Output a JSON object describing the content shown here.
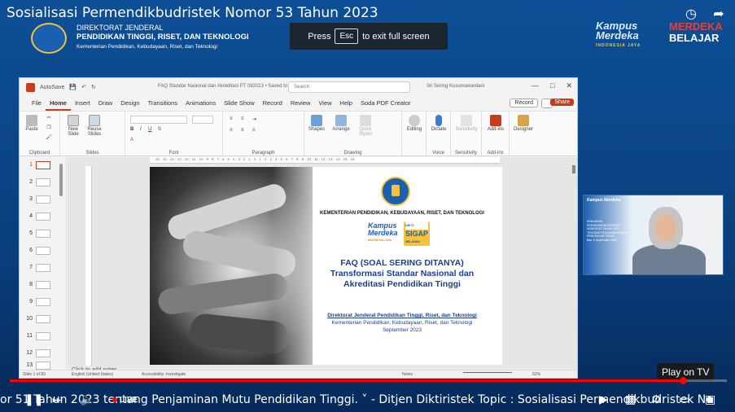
{
  "video": {
    "title": "Sosialisasi Permendikbudristek Nomor 53 Tahun 2023",
    "fullscreen_hint_press": "Press",
    "fullscreen_hint_key": "Esc",
    "fullscreen_hint_rest": "to exit full screen",
    "play_on_tv": "Play on TV",
    "live_label": "LIVE",
    "progress_fraction": 0.94,
    "ticker": "or 51 Tahun 2023 tentang Penjaminan Mutu Pendidikan Tinggi. ˅  -  Ditjen Diktiristek Topic : Sosialisasi Permendikbudristek No"
  },
  "branding": {
    "dirjen_line1": "DIREKTORAT JENDERAL",
    "dirjen_line2": "PENDIDIKAN TINGGI, RISET, DAN TEKNOLOGI",
    "dirjen_line3": "Kementerian Pendidikan, Kebudayaan, Riset, dan Teknologi",
    "km_line1": "Kampus",
    "km_line2": "Merdeka",
    "km_sub": "INDONESIA JAYA",
    "mb_line1": "MERDEKA",
    "mb_line2": "BELAJAR"
  },
  "ppt": {
    "titlebar": {
      "autosave": "AutoSave",
      "doc_title": "FAQ Standar Nasional dan Akreditasi PT 092023 • Saved to this PC",
      "search": "Search",
      "user": "Sri Sering Kusumawardani"
    },
    "menu": [
      "File",
      "Home",
      "Insert",
      "Draw",
      "Design",
      "Transitions",
      "Animations",
      "Slide Show",
      "Record",
      "Review",
      "View",
      "Help",
      "Soda PDF Creator"
    ],
    "record_label": "Record",
    "share_label": "Share",
    "ribbon": {
      "clipboard": "Clipboard",
      "paste": "Paste",
      "slides": "Slides",
      "new_slide": "New Slide",
      "reuse_slides": "Reuse Slides",
      "font": "Font",
      "paragraph": "Paragraph",
      "drawing": "Drawing",
      "shapes": "Shapes",
      "arrange": "Arrange",
      "quick_styles": "Quick Styles",
      "editing": "Editing",
      "voice": "Voice",
      "dictate": "Dictate",
      "sensitivity_group": "Sensitivity",
      "sensitivity": "Sensitivity",
      "addins_group": "Add-ins",
      "addins": "Add-ins",
      "designer": "Designer"
    },
    "thumbnails": [
      "1",
      "2",
      "3",
      "4",
      "5",
      "6",
      "7",
      "8",
      "9",
      "10",
      "11",
      "12",
      "13"
    ],
    "notes_placeholder": "Click to add notes",
    "status": {
      "slide": "Slide 1 of 83",
      "language": "English (United States)",
      "accessibility": "Accessibility: Investigate",
      "notes": "Notes",
      "zoom": "62%"
    },
    "ruler": "· 16 · 15 · 14 · 13 · 12 · 11 · 10 · 9 · 8 · 7 · 6 · 5 · 4 · 3 · 2 · 1 · 0 · 1 · 2 · 3 · 4 · 5 · 6 · 7 · 8 · 9 · 10 · 11 · 12 · 13 · 14 · 15 · 16 ·"
  },
  "slide": {
    "ministry": "KEMENTERIAN PENDIDIKAN, KEBUDAYAAN, RISET, DAN TEKNOLOGI",
    "km_line1": "Kampus",
    "km_line2": "Merdeka",
    "km_sub": "INDONESIA JAYA",
    "dikti_label": "DIKTI",
    "sigap_label": "SIGAP",
    "sigap_sub": "MELAYANI",
    "faq_line1": "FAQ (SOAL SERING DITANYA)",
    "faq_line2": "Transformasi Standar Nasional dan",
    "faq_line3": "Akreditasi Pendidikan Tinggi",
    "dir_line1": "Direktorat Jenderal Pendidikan Tinggi, Riset, dan Teknologi",
    "dir_line2": "Kementerian Pendidikan, Kebudayaan, Riset, dan Teknologi",
    "dir_line3": "September 2023"
  },
  "webcam": {
    "logo": "Kampus Merdeka",
    "slide_text": "KEBIJAKAN PERMENDIKBUDRISTEK NOMOR 53 TAHUN 2023 TENTANG PENJAMINAN MUTU PENDIDIKAN TINGGI",
    "date_text": "Bali, 6 September 2023"
  },
  "colors": {
    "ppt_accent": "#c43e1c",
    "slide_title": "#1a3f8f",
    "youtube_red": "#ff0000",
    "stage_blue": "#0d4f96"
  }
}
